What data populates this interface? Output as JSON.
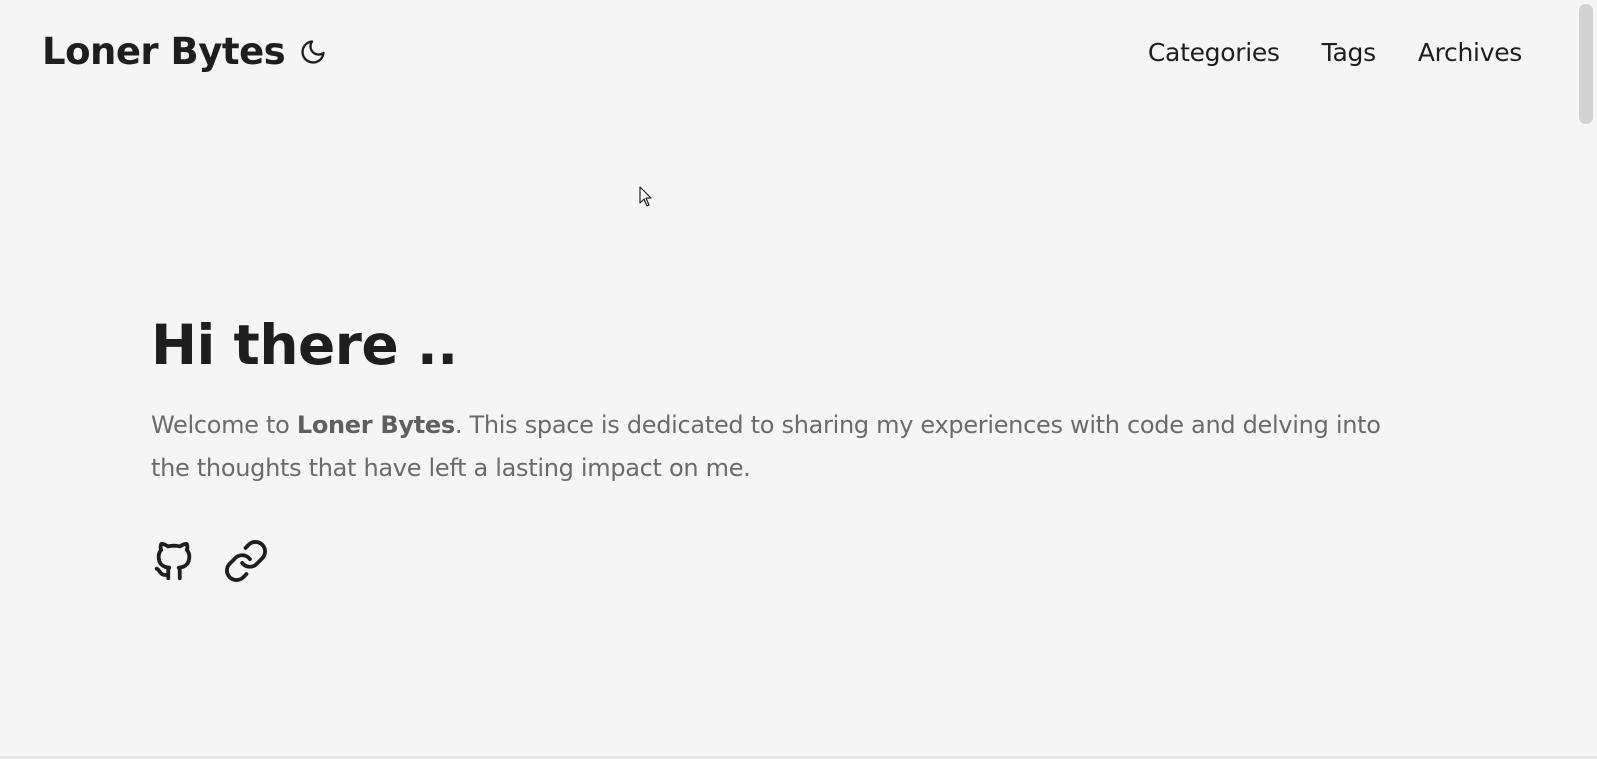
{
  "site": {
    "title": "Loner Bytes"
  },
  "nav": {
    "items": [
      {
        "label": "Categories"
      },
      {
        "label": "Tags"
      },
      {
        "label": "Archives"
      }
    ]
  },
  "hero": {
    "heading": "Hi there ..",
    "intro_prefix": "Welcome to ",
    "intro_bold": "Loner Bytes",
    "intro_suffix": ". This space is dedicated to sharing my experiences with code and delving into the thoughts that have left a lasting impact on me."
  },
  "social": {
    "icons": [
      "github-icon",
      "link-icon"
    ]
  },
  "theme_toggle": {
    "icon": "moon-icon"
  },
  "colors": {
    "background": "#f5f5f5",
    "text": "#1e1e1e",
    "muted_text": "#6b6b6b"
  }
}
